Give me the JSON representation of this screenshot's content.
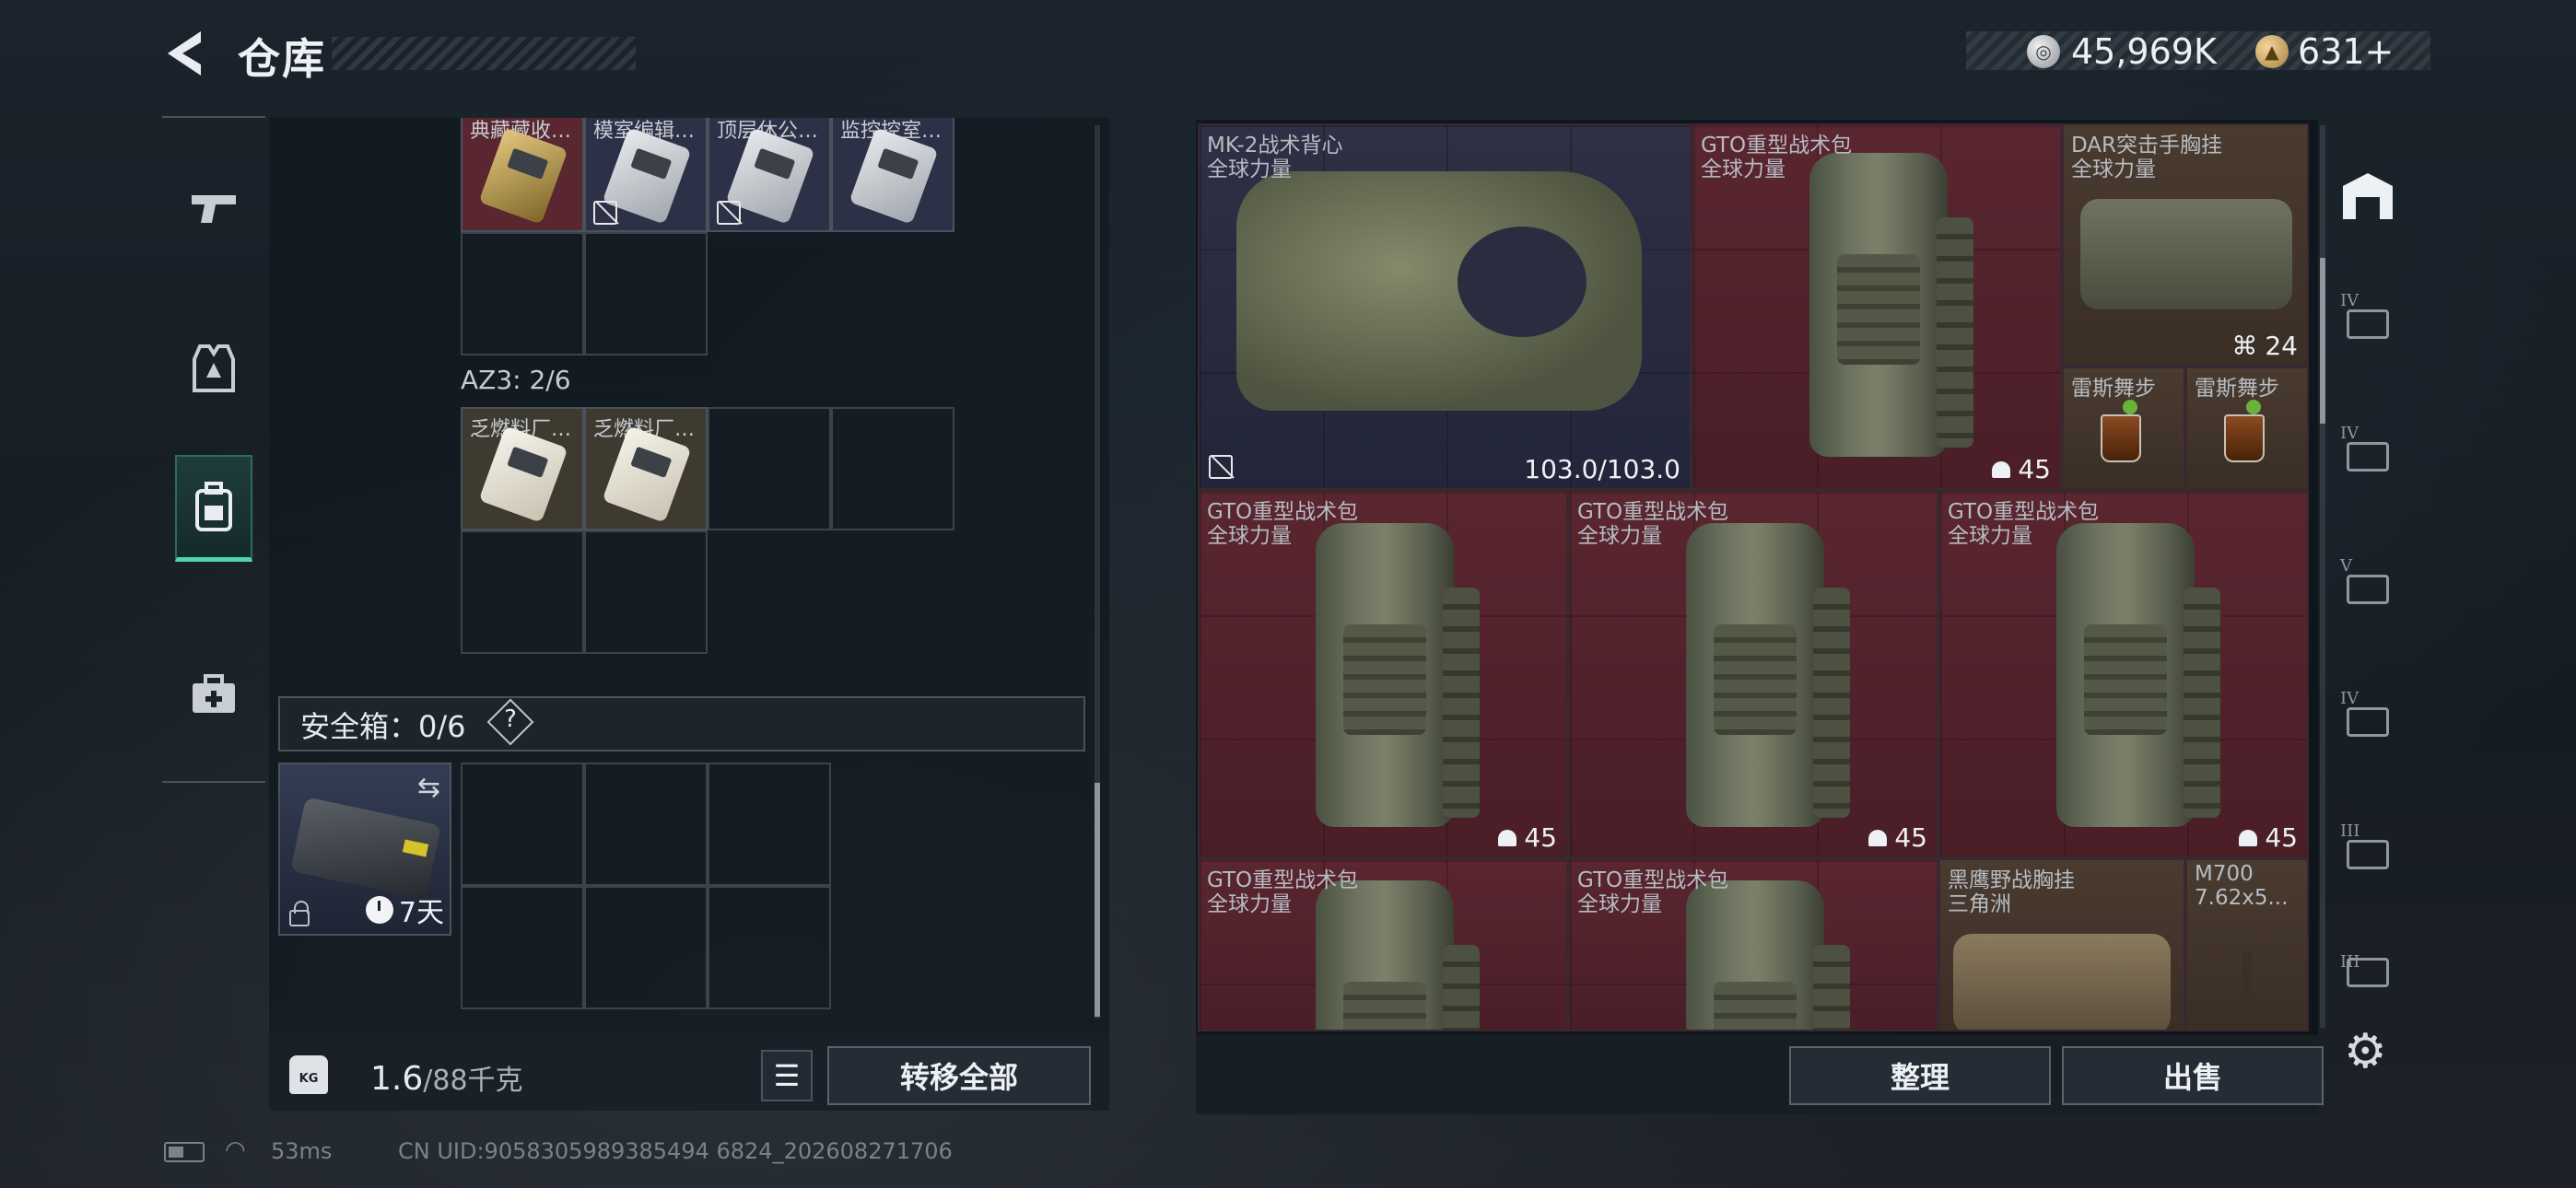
{
  "header": {
    "title": "仓库",
    "currencies": [
      {
        "icon": "silver-coin-icon",
        "value": "45,969K"
      },
      {
        "icon": "gold-coin-icon",
        "value": "631+"
      }
    ]
  },
  "left_nav": {
    "items": [
      {
        "icon": "pistol-icon",
        "active": false
      },
      {
        "icon": "armor-vest-icon",
        "active": false
      },
      {
        "icon": "backpack-icon",
        "active": true
      },
      {
        "icon": "medkit-icon",
        "active": false
      }
    ]
  },
  "inventory": {
    "top_items": [
      {
        "label": "典藏藏收…",
        "type": "gold-keycard"
      },
      {
        "label": "模室编辑…",
        "type": "silver-keycard"
      },
      {
        "label": "顶层休公…",
        "type": "silver-keycard"
      },
      {
        "label": "监控控室…",
        "type": "silver-keycard"
      }
    ],
    "az3_label": "AZ3: 2/6",
    "az3_items": [
      {
        "label": "乏燃料厂…"
      },
      {
        "label": "乏燃料厂…"
      }
    ],
    "safe_box": {
      "label": "安全箱：0/6",
      "help": "?",
      "timer": "7天"
    }
  },
  "left_footer": {
    "weight": "1.6",
    "weight_unit": "/88千克",
    "kg_badge": "KG",
    "transfer_all": "转移全部"
  },
  "stash": {
    "items": [
      {
        "name": "MK-2战术背心",
        "sub": "全球力量",
        "stat": "103.0/103.0"
      },
      {
        "name": "GTO重型战术包",
        "sub": "全球力量",
        "stat": "45"
      },
      {
        "name": "DAR突击手胸挂",
        "sub": "全球力量",
        "stat": "24"
      },
      {
        "name": "雷斯舞步",
        "sub": ""
      },
      {
        "name": "雷斯舞步",
        "sub": ""
      },
      {
        "name": "GTO重型战术包",
        "sub": "全球力量",
        "stat": "45"
      },
      {
        "name": "GTO重型战术包",
        "sub": "全球力量",
        "stat": "45"
      },
      {
        "name": "GTO重型战术包",
        "sub": "全球力量",
        "stat": "45"
      },
      {
        "name": "GTO重型战术包",
        "sub": "全球力量"
      },
      {
        "name": "GTO重型战术包",
        "sub": "全球力量"
      },
      {
        "name": "黑鹰野战胸挂",
        "sub": "三角洲"
      },
      {
        "name": "M700",
        "sub": "7.62x5..."
      }
    ]
  },
  "right_rail": {
    "tiers": [
      "IV",
      "IV",
      "V",
      "IV",
      "III",
      "III"
    ]
  },
  "right_footer": {
    "sort": "整理",
    "sell": "出售"
  },
  "status": {
    "ping": "53ms",
    "uid": "CN UID:9058305989385494 6824_202608271706"
  }
}
